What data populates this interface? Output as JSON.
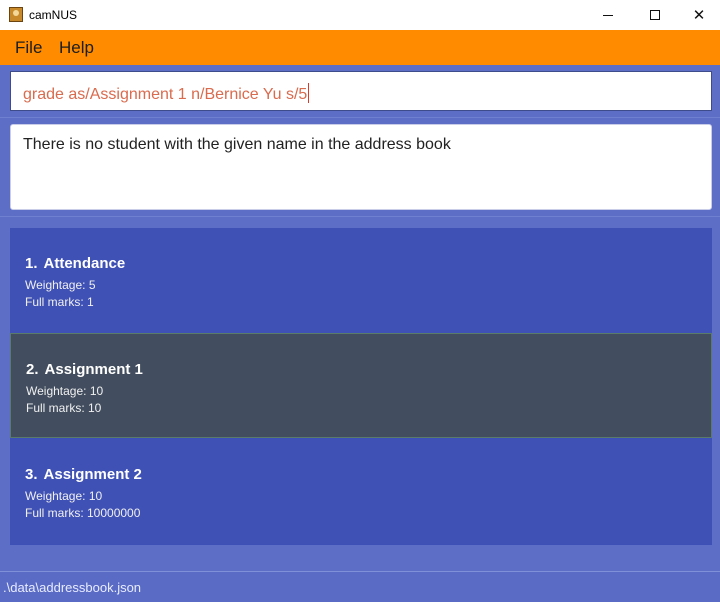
{
  "window": {
    "title": "camNUS"
  },
  "menu": {
    "items": [
      "File",
      "Help"
    ]
  },
  "command": {
    "value": "grade as/Assignment 1 n/Bernice Yu s/5"
  },
  "result": {
    "message": "There is no student with the given name in the address book"
  },
  "assignments": [
    {
      "index": "1.",
      "name": "Attendance",
      "weightage": "Weightage: 5",
      "full_marks": "Full marks: 1",
      "selected": false
    },
    {
      "index": "2.",
      "name": "Assignment 1",
      "weightage": "Weightage: 10",
      "full_marks": "Full marks: 10",
      "selected": true
    },
    {
      "index": "3.",
      "name": "Assignment 2",
      "weightage": "Weightage: 10",
      "full_marks": "Full marks: 10000000",
      "selected": false
    }
  ],
  "status": {
    "path": ".\\data\\addressbook.json"
  },
  "colors": {
    "menu_bg": "#ff8c00",
    "card_bg": "#3f51b5",
    "selected_bg": "#424e5f",
    "command_text": "#d96b4e"
  }
}
